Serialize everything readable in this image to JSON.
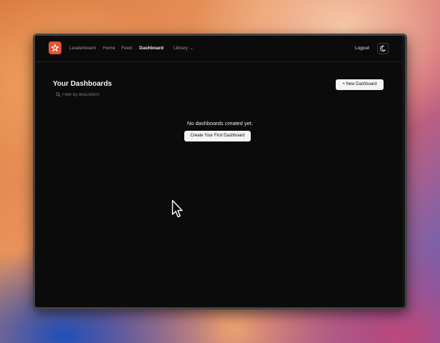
{
  "nav": {
    "items": [
      {
        "label": "Leaderboard"
      },
      {
        "label": "Home"
      },
      {
        "label": "Feed"
      },
      {
        "label": "Dashboard"
      },
      {
        "label": "Library"
      }
    ],
    "logout_label": "Logout"
  },
  "page": {
    "title": "Your Dashboards",
    "new_button_label": "+ New Dashboard",
    "filter_placeholder": "Filter by description",
    "empty_message": "No dashboards created yet.",
    "create_first_label": "Create Your First Dashboard"
  },
  "colors": {
    "accent": "#e8522e",
    "background": "#0b0b0b",
    "button_bg": "#f4f4f4"
  },
  "icons": {
    "logo": "brand-logo-icon",
    "library_chevron": "chevron-down-icon",
    "theme": "theme-toggle-icon",
    "filter": "search-icon",
    "pointer": "mouse-cursor-icon"
  }
}
